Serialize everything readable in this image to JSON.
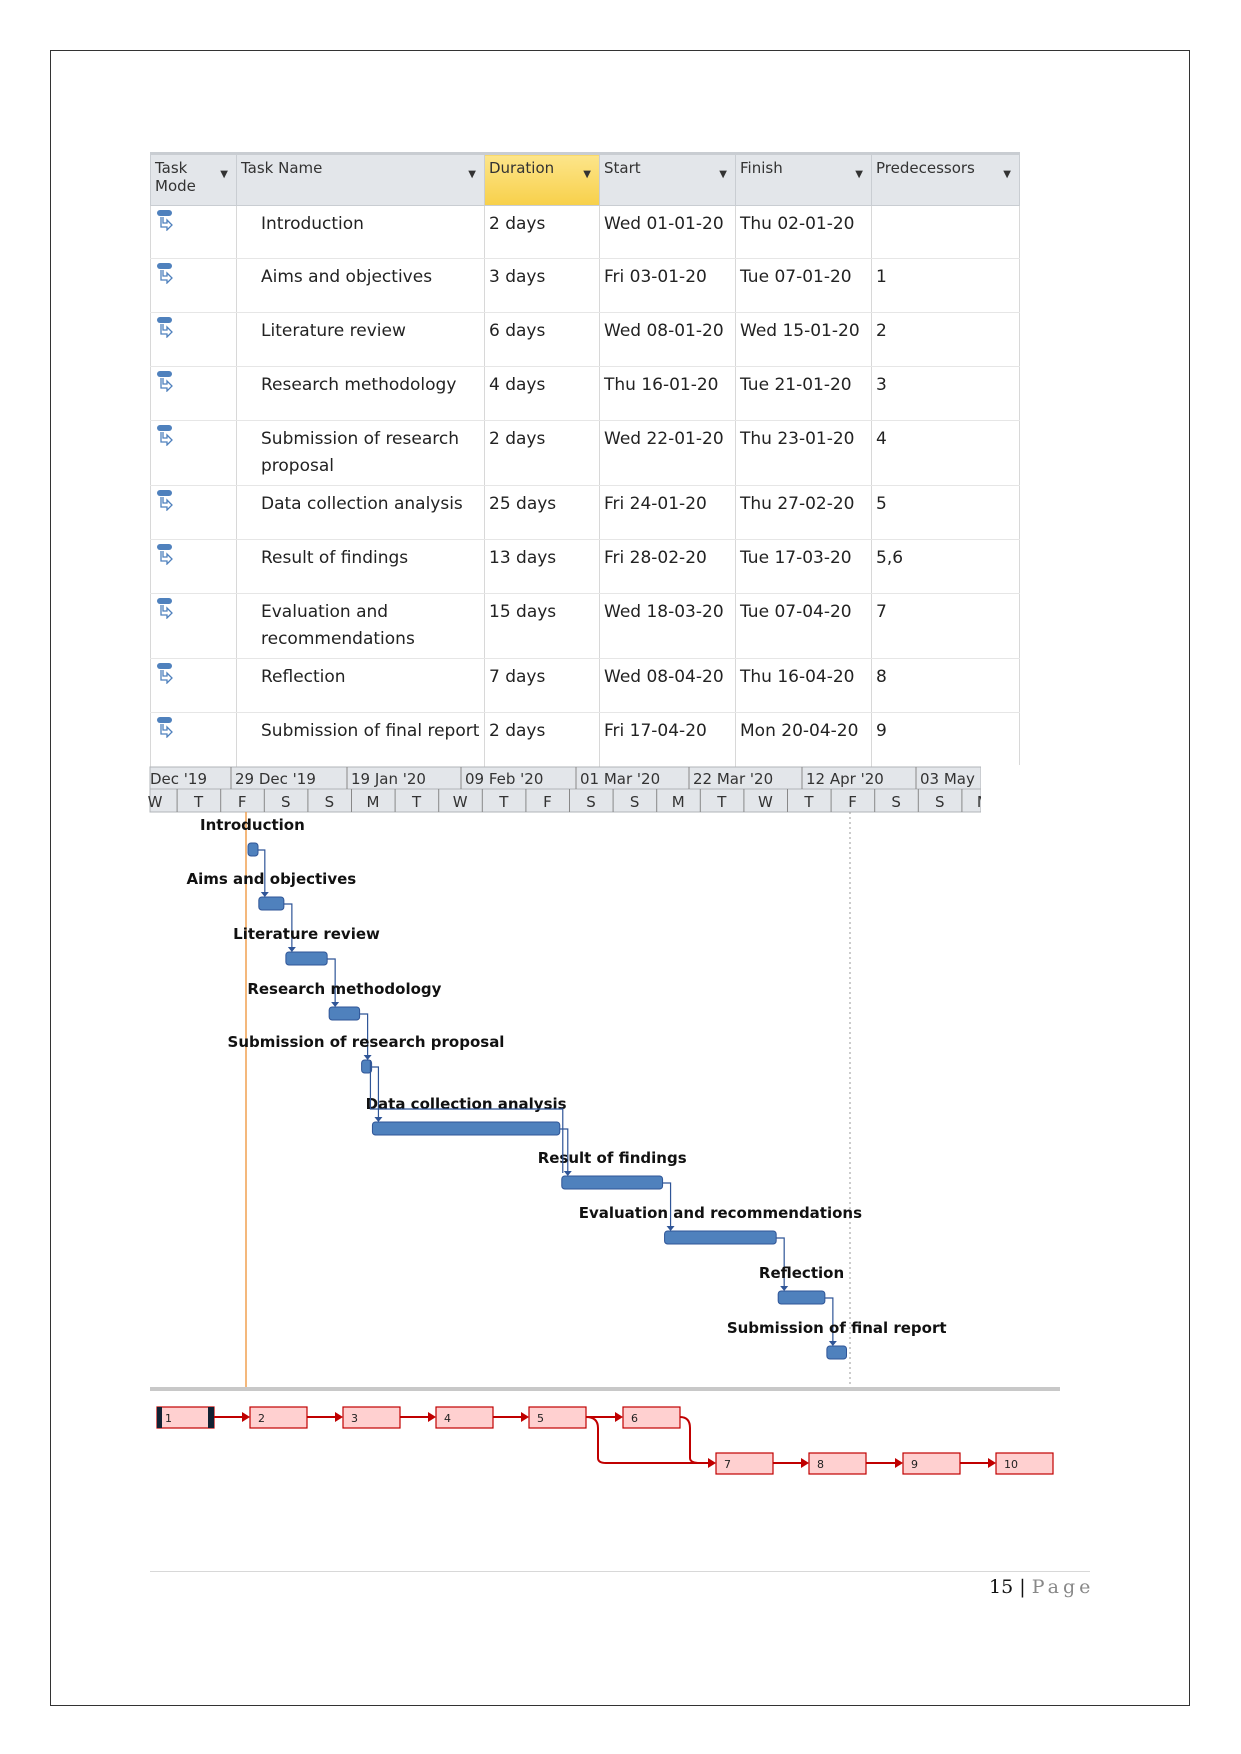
{
  "table": {
    "headers": {
      "mode": "Task Mode",
      "name": "Task Name",
      "duration": "Duration",
      "start": "Start",
      "finish": "Finish",
      "pred": "Predecessors"
    },
    "rows": [
      {
        "id": "1",
        "name": "Introduction",
        "duration": "2 days",
        "start": "Wed 01-01-20",
        "finish": "Thu 02-01-20",
        "pred": ""
      },
      {
        "id": "2",
        "name": "Aims and objectives",
        "duration": "3 days",
        "start": "Fri 03-01-20",
        "finish": "Tue 07-01-20",
        "pred": "1"
      },
      {
        "id": "3",
        "name": "Literature review",
        "duration": "6 days",
        "start": "Wed 08-01-20",
        "finish": "Wed 15-01-20",
        "pred": "2"
      },
      {
        "id": "4",
        "name": "Research methodology",
        "duration": "4 days",
        "start": "Thu 16-01-20",
        "finish": "Tue 21-01-20",
        "pred": "3"
      },
      {
        "id": "5",
        "name": "Submission of research proposal",
        "duration": "2 days",
        "start": "Wed 22-01-20",
        "finish": "Thu 23-01-20",
        "pred": "4"
      },
      {
        "id": "6",
        "name": "Data collection analysis",
        "duration": "25 days",
        "start": "Fri 24-01-20",
        "finish": "Thu 27-02-20",
        "pred": "5"
      },
      {
        "id": "7",
        "name": "Result of findings",
        "duration": "13 days",
        "start": "Fri 28-02-20",
        "finish": "Tue 17-03-20",
        "pred": "5,6"
      },
      {
        "id": "8",
        "name": "Evaluation and recommendations",
        "duration": "15 days",
        "start": "Wed 18-03-20",
        "finish": "Tue 07-04-20",
        "pred": "7"
      },
      {
        "id": "9",
        "name": "Reflection",
        "duration": "7 days",
        "start": "Wed 08-04-20",
        "finish": "Thu 16-04-20",
        "pred": "8"
      },
      {
        "id": "10",
        "name": "Submission of final report",
        "duration": "2 days",
        "start": "Fri 17-04-20",
        "finish": "Mon 20-04-20",
        "pred": "9"
      }
    ]
  },
  "timescale": {
    "major": [
      "Dec '19",
      "29 Dec '19",
      "19 Jan '20",
      "09 Feb '20",
      "01 Mar '20",
      "22 Mar '20",
      "12 Apr '20",
      "03 May"
    ],
    "minor": [
      "W",
      "T",
      "F",
      "S",
      "S",
      "M",
      "T",
      "W",
      "T",
      "F",
      "S",
      "S",
      "M",
      "T",
      "W",
      "T",
      "F",
      "S",
      "S",
      "M"
    ]
  },
  "network": {
    "row1": [
      "1",
      "2",
      "3",
      "4",
      "5",
      "6"
    ],
    "row2": [
      "7",
      "8",
      "9",
      "10"
    ]
  },
  "colors": {
    "bar": "#4f81bd",
    "network_line": "#c00000",
    "network_fill": "#ffd0d0",
    "today_line": "#f0a050",
    "header_highlight": "#f7d04a"
  },
  "icons": {
    "task_mode": "auto-scheduled-task-icon",
    "dropdown": "chevron-down-icon"
  },
  "footer": {
    "page_number": "15",
    "separator": "|",
    "page_label": "Page"
  }
}
